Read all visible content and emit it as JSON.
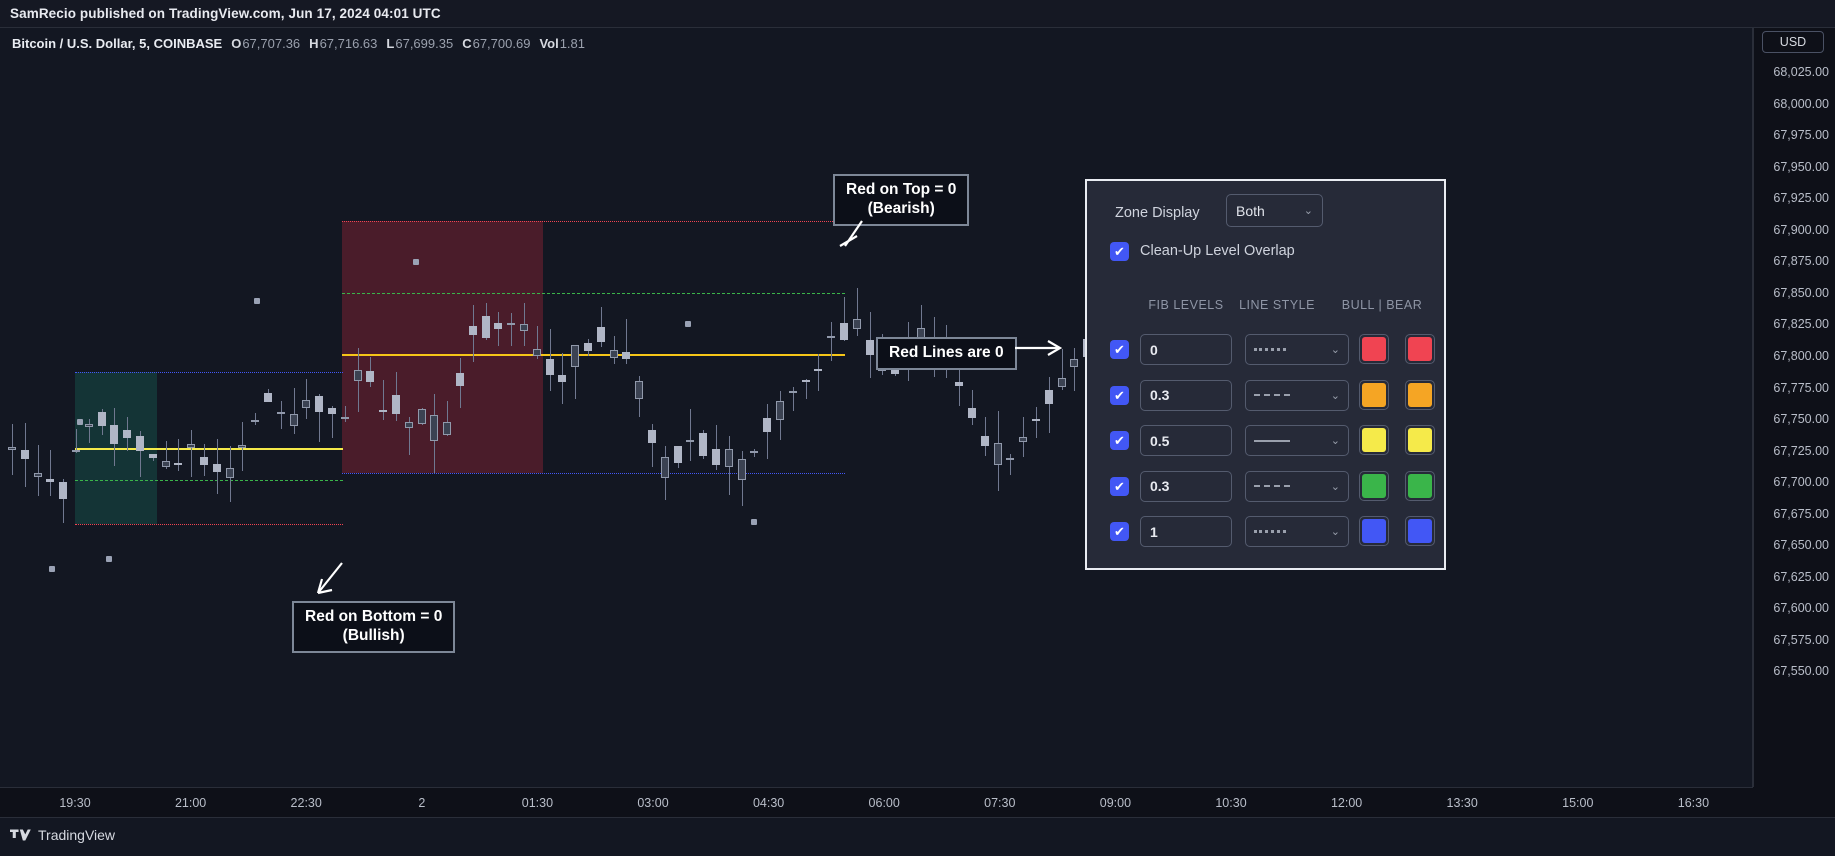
{
  "publisher_bar": "SamRecio published on TradingView.com, Jun 17, 2024 04:01 UTC",
  "chart": {
    "symbol_title": "Bitcoin / U.S. Dollar, 5, COINBASE",
    "ohlc": {
      "open_key": "O",
      "open_value": "67,707.36",
      "high_key": "H",
      "high_value": "67,716.63",
      "low_key": "L",
      "low_value": "67,699.35",
      "close_key": "C",
      "close_value": "67,700.69",
      "vol_key": "Vol",
      "vol_value": "1.81"
    },
    "currency_chip": "USD",
    "price_labels": [
      "68,025.00",
      "68,000.00",
      "67,975.00",
      "67,950.00",
      "67,925.00",
      "67,900.00",
      "67,875.00",
      "67,850.00",
      "67,825.00",
      "67,800.00",
      "67,775.00",
      "67,750.00",
      "67,725.00",
      "67,700.00",
      "67,675.00",
      "67,650.00",
      "67,625.00",
      "67,600.00",
      "67,575.00",
      "67,550.00"
    ],
    "time_labels": [
      "19:30",
      "21:00",
      "22:30",
      "2",
      "01:30",
      "03:00",
      "04:30",
      "06:00",
      "07:30",
      "09:00",
      "10:30",
      "12:00",
      "13:30",
      "15:00",
      "16:30"
    ]
  },
  "annotations": [
    {
      "id": "red-on-top",
      "text": "Red on Top = 0\n(Bearish)"
    },
    {
      "id": "red-lines-are-0",
      "text": "Red Lines are 0"
    },
    {
      "id": "red-on-bottom",
      "text": "Red on Bottom = 0\n(Bullish)"
    }
  ],
  "settings": {
    "zone_display_label": "Zone Display",
    "zone_display_value": "Both",
    "zone_display_options": [
      "Both"
    ],
    "cleanup_label": "Clean-Up Level Overlap",
    "cleanup_checked": true,
    "checkbox_color": "#4257f5",
    "columns": {
      "fib_levels": "FIB LEVELS",
      "line_style": "LINE STYLE",
      "bull_bear": "BULL | BEAR"
    },
    "rows": [
      {
        "enabled": true,
        "level": "0",
        "style": "dotted",
        "bull_color": "#f04452",
        "bear_color": "#f04452"
      },
      {
        "enabled": true,
        "level": "0.3",
        "style": "dashed",
        "bull_color": "#f5a524",
        "bear_color": "#f5a524"
      },
      {
        "enabled": true,
        "level": "0.5",
        "style": "solid",
        "bull_color": "#f5ea4a",
        "bear_color": "#f5ea4a"
      },
      {
        "enabled": true,
        "level": "0.3",
        "style": "dashed",
        "bull_color": "#3ab54a",
        "bear_color": "#3ab54a"
      },
      {
        "enabled": true,
        "level": "1",
        "style": "dotted",
        "bull_color": "#4257f5",
        "bear_color": "#4257f5"
      }
    ],
    "checkmark_glyph": "✔",
    "chevron_glyph": "▼"
  },
  "footer": {
    "brand": "TradingView"
  },
  "chart_data": {
    "type": "candlestick",
    "title": "Bitcoin / U.S. Dollar, 5, COINBASE",
    "ylabel": "USD",
    "ylim": [
      67540,
      68035
    ],
    "xlabel": "",
    "grid": false,
    "zones": [
      {
        "name": "bullish-zone",
        "fill": "#167868",
        "x_start": "20:00",
        "x_end": "22:45",
        "top": 67760,
        "bottom": 67640
      },
      {
        "name": "bearish-zone",
        "fill": "#962337",
        "x_start": "22:50",
        "x_end": "02:45",
        "top": 67880,
        "bottom": 67680
      }
    ],
    "levels": [
      {
        "name": "bull-0",
        "price": 67640,
        "color": "#f04452",
        "style": "dotted"
      },
      {
        "name": "bull-0.3",
        "price": 67675,
        "color": "#3ab54a",
        "style": "dashed"
      },
      {
        "name": "bull-0.5",
        "price": 67700,
        "color": "#f5ea4a",
        "style": "solid"
      },
      {
        "name": "bull-1",
        "price": 67760,
        "color": "#4257f5",
        "style": "dotted"
      },
      {
        "name": "bear-0",
        "price": 67880,
        "color": "#f04452",
        "style": "dotted"
      },
      {
        "name": "bear-0.3",
        "price": 67823,
        "color": "#3ab54a",
        "style": "dashed"
      },
      {
        "name": "bear-0.5",
        "price": 67775,
        "color": "#f5ea4a",
        "style": "solid"
      },
      {
        "name": "bear-1",
        "price": 67680,
        "color": "#4257f5",
        "style": "dotted"
      }
    ]
  }
}
